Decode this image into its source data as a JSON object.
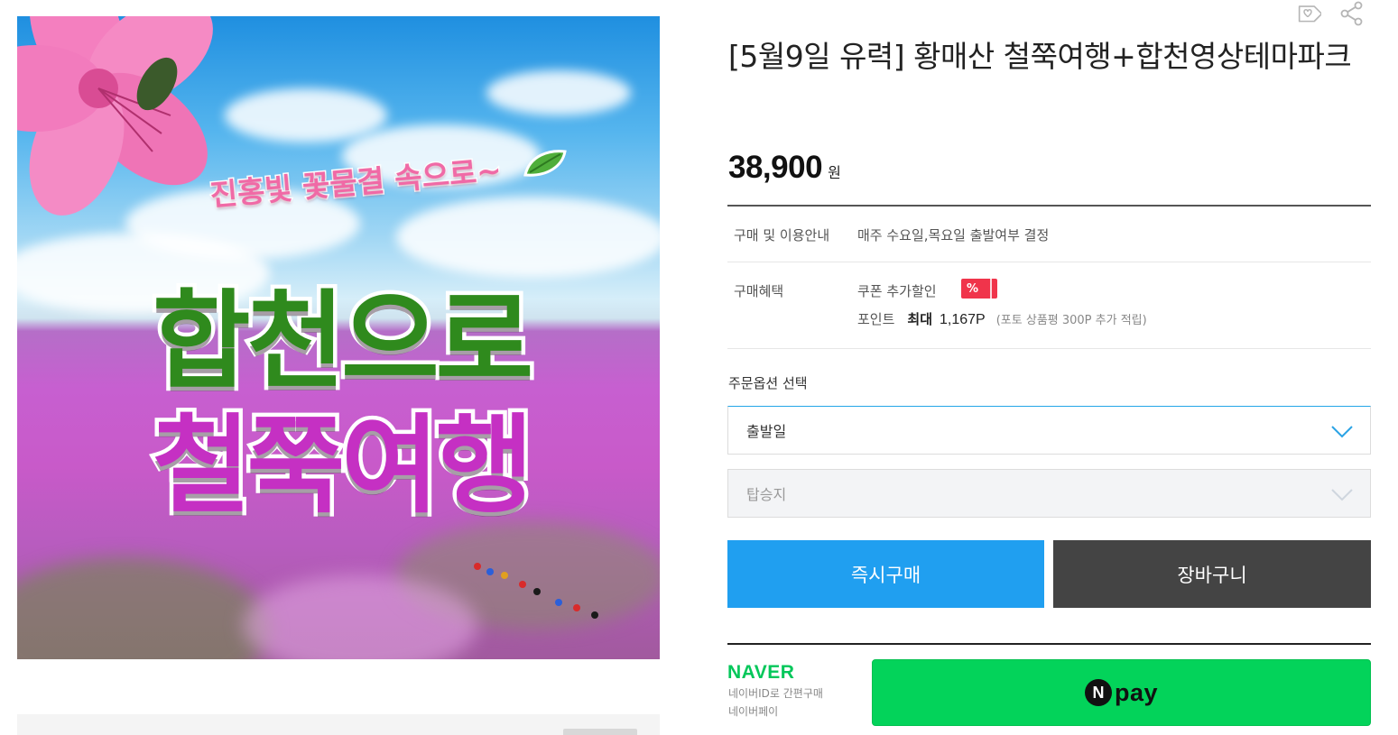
{
  "product": {
    "title": "[5월9일 유력] 황매산 철쭉여행+합천영상테마파크",
    "price": "38,900",
    "price_unit": "원"
  },
  "image": {
    "tagline": "진홍빛 꽃물결 속으로~",
    "headline_line1": "합천으로",
    "headline_line2": "철쭉여행"
  },
  "actions": {
    "wish_icon": "tag-heart-icon",
    "share_icon": "share-icon"
  },
  "info": {
    "usage_label": "구매 및 이용안내",
    "usage_text": "매주 수요일,목요일 출발여부 결정",
    "benefit_label": "구매혜택",
    "coupon_text": "쿠폰 추가할인",
    "coupon_badge": "%",
    "point_label": "포인트",
    "point_max": "최대",
    "point_value": "1,167P",
    "point_note": "(포토 상품평 300P 추가 적립)"
  },
  "options": {
    "heading": "주문옵션 선택",
    "date_placeholder": "출발일",
    "boarding_placeholder": "탑승지"
  },
  "buttons": {
    "buy_now": "즉시구매",
    "cart": "장바구니"
  },
  "naver": {
    "logo": "NAVER",
    "sub1": "네이버ID로 간편구매",
    "sub2": "네이버페이",
    "pay_mark": "N",
    "pay_text": "pay"
  },
  "colors": {
    "buy_button": "#209ff0",
    "cart_button": "#444444",
    "npay_button": "#03d35a",
    "naver_green": "#03c75a",
    "coupon_red": "#f0344b"
  }
}
